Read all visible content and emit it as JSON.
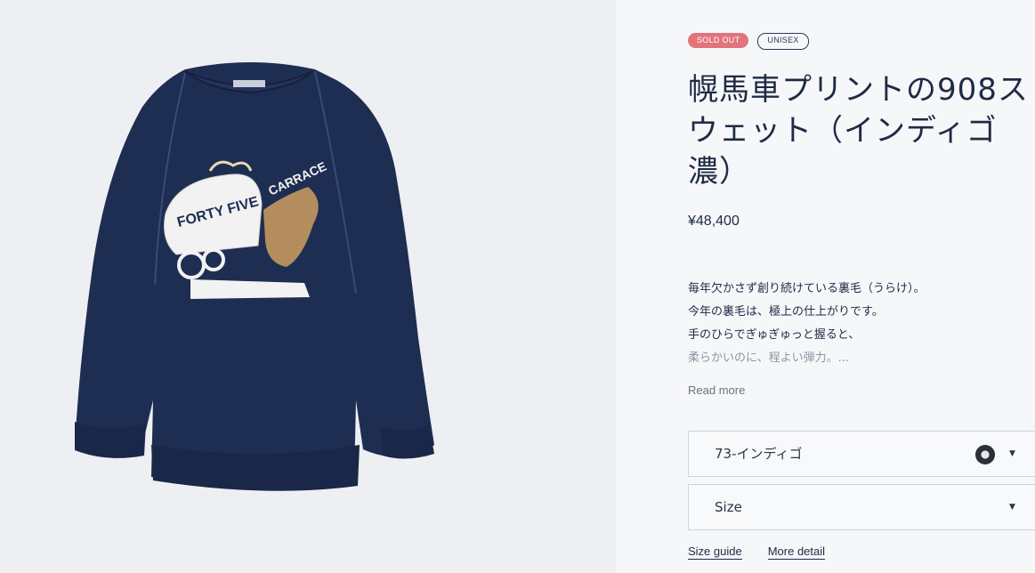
{
  "product": {
    "badges": {
      "sold_out": "SOLD OUT",
      "unisex": "UNISEX"
    },
    "title_lines": [
      "幌馬車プリントの908ス",
      "ウェット（インディゴ",
      "濃）"
    ],
    "price": "¥48,400",
    "description_lines": [
      "毎年欠かさず創り続けている裏毛（うらけ）。",
      "今年の裏毛は、極上の仕上がりです。",
      "手のひらでぎゅぎゅっと握ると、",
      "柔らかいのに、程よい弾力。..."
    ],
    "read_more": "Read more",
    "color_select": {
      "value": "73-インディゴ",
      "swatch_icon": "color-swatch-icon"
    },
    "size_select": {
      "value": "Size"
    },
    "links": {
      "size_guide": "Size guide",
      "more_detail": "More detail"
    }
  },
  "image": {
    "alt": "navy indigo sweatshirt with covered wagon print",
    "print_text": {
      "left": "FORTY FIVE",
      "right": "CARRACE"
    },
    "colors": {
      "fabric": "#1e2d52",
      "background": "#edeff2",
      "print": "#f2f2f2",
      "horse": "#b48d5e"
    }
  }
}
